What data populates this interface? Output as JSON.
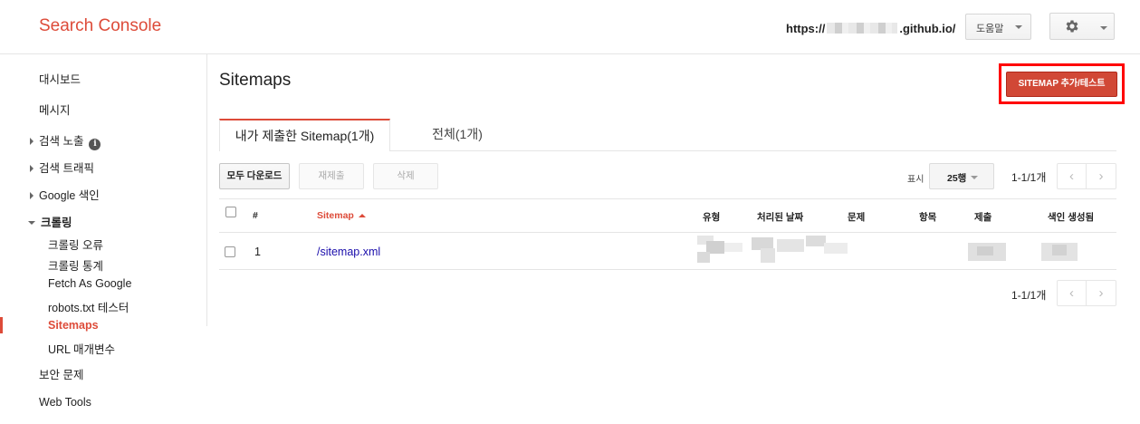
{
  "header": {
    "app_title": "Search Console",
    "site_url_prefix": "https://",
    "site_url_suffix": ".github.io/",
    "help_label": "도움말"
  },
  "sidebar": {
    "dashboard": "대시보드",
    "messages": "메시지",
    "search_appearance": "검색 노출",
    "search_traffic": "검색 트래픽",
    "google_index": "Google 색인",
    "crawl": "크롤링",
    "crawl_errors": "크롤링 오류",
    "crawl_stats": "크롤링 통계",
    "fetch_as_google": "Fetch As Google",
    "robots_tester": "robots.txt 테스터",
    "sitemaps": "Sitemaps",
    "url_parameters": "URL 매개변수",
    "security_issues": "보안 문제",
    "web_tools": "Web Tools"
  },
  "main": {
    "title": "Sitemaps",
    "add_test_button": "SITEMAP 추가/테스트",
    "tabs": [
      {
        "label": "내가 제출한 Sitemap(1개)",
        "active": true
      },
      {
        "label": "전체(1개)",
        "active": false
      }
    ],
    "toolbar": {
      "download_all": "모두 다운로드",
      "resubmit": "재제출",
      "delete": "삭제",
      "show_label": "표시",
      "rows_per_page": "25행",
      "range_text": "1-1/1개"
    },
    "table": {
      "columns": [
        "#",
        "Sitemap",
        "유형",
        "처리된 날짜",
        "문제",
        "항목",
        "제출",
        "색인 생성됨"
      ],
      "rows": [
        {
          "index": "1",
          "sitemap": "/sitemap.xml"
        }
      ]
    },
    "footer_range_text": "1-1/1개"
  },
  "colors": {
    "brand_red": "#dd4b39",
    "add_button_bg": "#d14836",
    "highlight_border": "#ff0000",
    "link_blue": "#1a0dab"
  },
  "icons": {
    "info": "info-icon",
    "gear": "gear-icon",
    "prev": "chevron-left-icon",
    "next": "chevron-right-icon",
    "sort": "sort-ascending-icon"
  }
}
